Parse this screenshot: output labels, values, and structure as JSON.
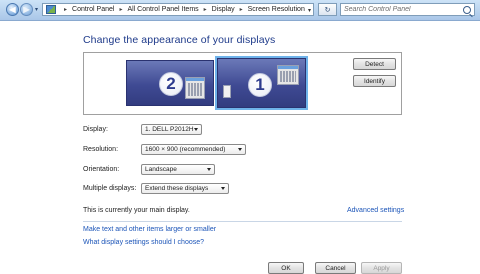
{
  "address": {
    "crumbs": [
      "Control Panel",
      "All Control Panel Items",
      "Display",
      "Screen Resolution"
    ],
    "separator": "▸",
    "search_placeholder": "Search Control Panel"
  },
  "icons": {
    "back": "back-arrow-icon",
    "forward": "forward-arrow-icon",
    "refresh": "refresh-icon",
    "search": "search-icon",
    "control_panel": "control-panel-icon"
  },
  "glyphs": {
    "back": "◀",
    "forward": "▶",
    "dropdown": "▾",
    "refresh": "↻"
  },
  "page": {
    "title": "Change the appearance of your displays"
  },
  "monitors": [
    {
      "number": "2"
    },
    {
      "number": "1"
    }
  ],
  "buttons": {
    "detect": "Detect",
    "identify": "Identify",
    "ok": "OK",
    "cancel": "Cancel",
    "apply": "Apply"
  },
  "settings": {
    "display": {
      "label": "Display:",
      "value": "1. DELL P2012H"
    },
    "resolution": {
      "label": "Resolution:",
      "value": "1600 × 900 (recommended)"
    },
    "orientation": {
      "label": "Orientation:",
      "value": "Landscape"
    },
    "multiple": {
      "label": "Multiple displays:",
      "value": "Extend these displays"
    }
  },
  "status": "This is currently your main display.",
  "links": {
    "advanced": "Advanced settings",
    "text_size": "Make text and other items larger or smaller",
    "help": "What display settings should I choose?"
  },
  "colors": {
    "title_blue": "#1e3a8a",
    "link_blue": "#1c55b8",
    "monitor_selected_outline": "#6fb3ea"
  }
}
